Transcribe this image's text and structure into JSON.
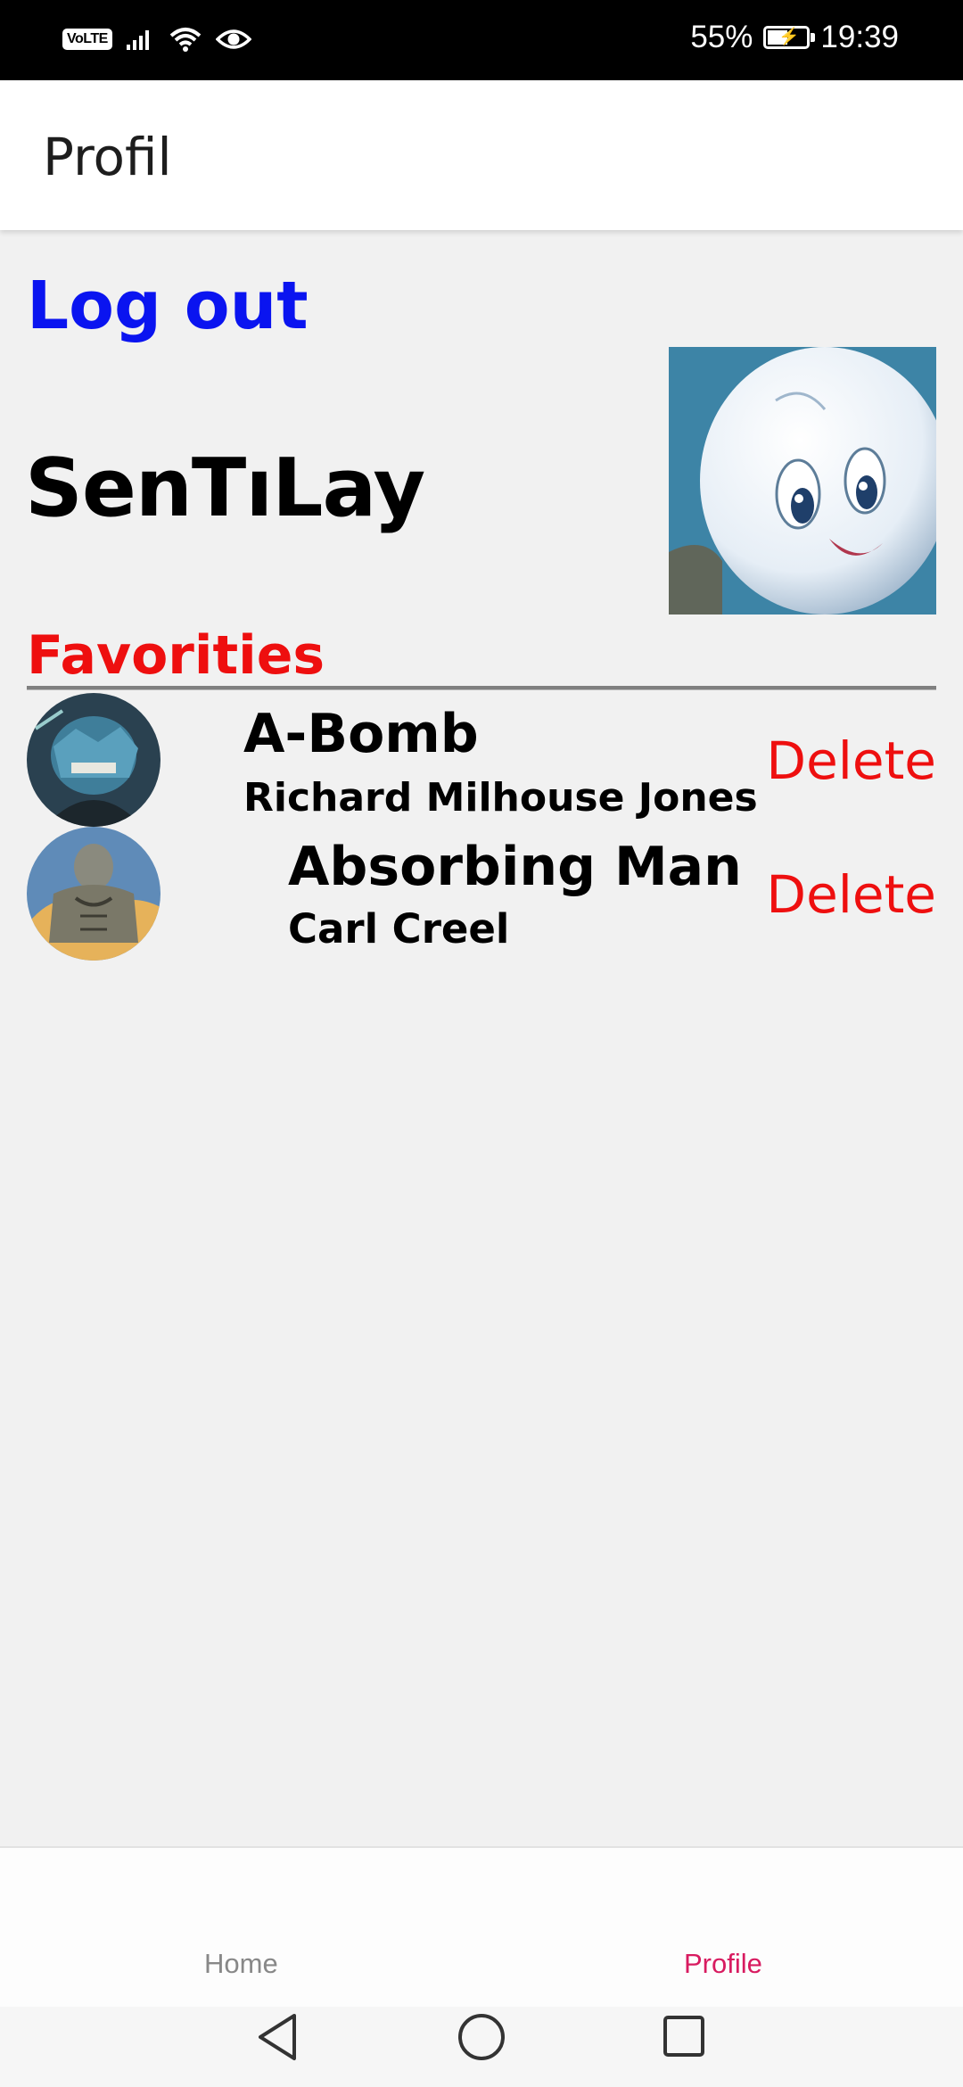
{
  "status_bar": {
    "volte": "VoLTE",
    "battery_percent": "55%",
    "battery_level": 0.55,
    "time": "19:39",
    "icons": [
      "volte-icon",
      "signal-icon",
      "wifi-icon",
      "eye-icon",
      "battery-icon"
    ]
  },
  "app_bar": {
    "title": "Profil"
  },
  "profile": {
    "logout_label": "Log out",
    "username": "SenTıLay",
    "favorites_heading": "Favorities",
    "favorites": [
      {
        "name": "A-Bomb",
        "real_name": "Richard Milhouse Jones",
        "delete_label": "Delete"
      },
      {
        "name": "Absorbing Man",
        "real_name": "Carl Creel",
        "delete_label": "Delete"
      }
    ]
  },
  "bottom_nav": {
    "items": [
      {
        "label": "Home",
        "active": false
      },
      {
        "label": "Profile",
        "active": true
      }
    ],
    "active_color": "#d81b60",
    "inactive_color": "#888888"
  },
  "colors": {
    "logout": "#0a14f0",
    "favorites_heading": "#ee0f0f",
    "delete": "#ee0f0f",
    "background": "#f1f1f1"
  }
}
